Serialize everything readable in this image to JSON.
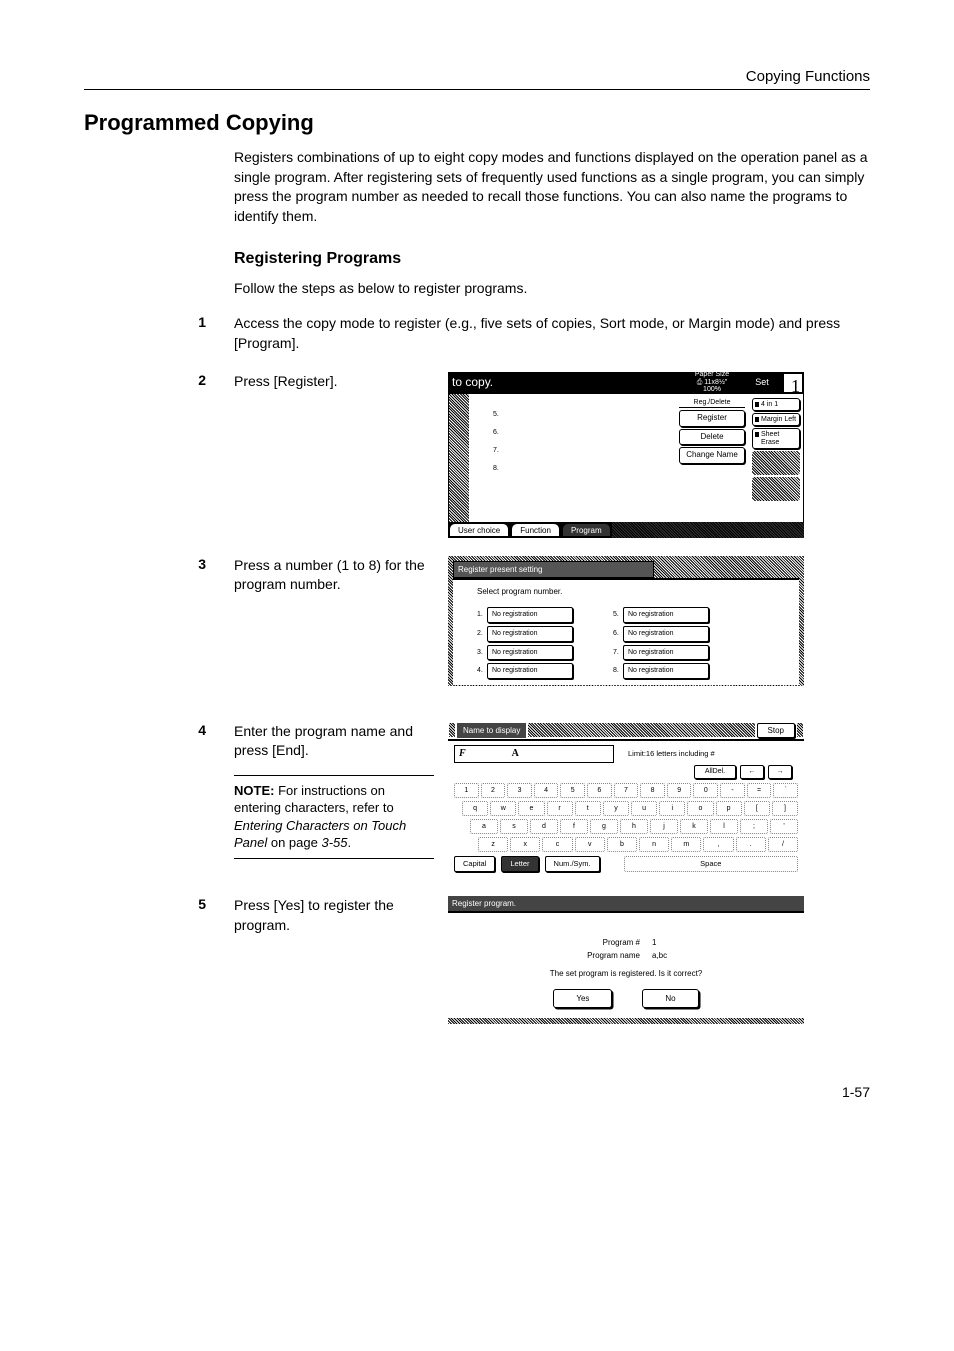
{
  "header": {
    "title": "Copying Functions"
  },
  "h1": "Programmed Copying",
  "intro": "Registers combinations of up to eight copy modes and functions displayed on the operation panel as a single program. After registering sets of frequently used functions as a single program, you can simply press the program number as needed to recall those functions. You can also name the programs to identify them.",
  "h2": "Registering Programs",
  "follow": "Follow the steps as below to register programs.",
  "steps": {
    "s1": {
      "num": "1",
      "text": "Access the copy mode to register (e.g., five sets of copies, Sort mode, or Margin mode) and press [Program]."
    },
    "s2": {
      "num": "2",
      "text": "Press [Register]."
    },
    "s3": {
      "num": "3",
      "text": "Press a number (1 to 8) for the program number."
    },
    "s4": {
      "num": "4",
      "text": "Enter the program name and press [End]."
    },
    "s5": {
      "num": "5",
      "text": "Press [Yes] to register the program."
    }
  },
  "note": {
    "label": "NOTE:",
    "text1": " For instructions on entering characters, refer to ",
    "ital": "Entering Characters on Touch Panel",
    "text2": " on page ",
    "page": "3-55",
    "period": "."
  },
  "screen1": {
    "title": "to copy.",
    "paper_size_label": "Paper Size",
    "paper_size": "11x8½\"",
    "zoom": "100%",
    "set": "Set",
    "count": "1",
    "list": [
      "5.",
      "6.",
      "7.",
      "8."
    ],
    "reg_delete": "Reg./Delete",
    "buttons": [
      "Register",
      "Delete",
      "Change Name"
    ],
    "side": [
      "4 in 1",
      "Margin Left",
      "Sheet Erase"
    ],
    "tabs": [
      "User choice",
      "Function",
      "Program"
    ]
  },
  "screen2": {
    "header": "Register present setting",
    "sub": "Select program number.",
    "cells": [
      {
        "n": "1.",
        "t": "No registration"
      },
      {
        "n": "2.",
        "t": "No registration"
      },
      {
        "n": "3.",
        "t": "No registration"
      },
      {
        "n": "4.",
        "t": "No registration"
      },
      {
        "n": "5.",
        "t": "No registration"
      },
      {
        "n": "6.",
        "t": "No registration"
      },
      {
        "n": "7.",
        "t": "No registration"
      },
      {
        "n": "8.",
        "t": "No registration"
      }
    ]
  },
  "screen3": {
    "title": "Name to display",
    "stop": "Stop",
    "input_value": "F",
    "cursor": "A",
    "limit": "Limit:16 letters including #",
    "alldel": "AllDel.",
    "arrow_l": "←",
    "arrow_r": "→",
    "rows": [
      [
        "1",
        "2",
        "3",
        "4",
        "5",
        "6",
        "7",
        "8",
        "9",
        "0",
        "-",
        "=",
        "`"
      ],
      [
        "q",
        "w",
        "e",
        "r",
        "t",
        "y",
        "u",
        "i",
        "o",
        "p",
        "[",
        "]"
      ],
      [
        "a",
        "s",
        "d",
        "f",
        "g",
        "h",
        "j",
        "k",
        "l",
        ";",
        "'"
      ],
      [
        "z",
        "x",
        "c",
        "v",
        "b",
        "n",
        "m",
        ",",
        ".",
        "/"
      ]
    ],
    "tabs": [
      "Capital",
      "Letter",
      "Num./Sym."
    ],
    "space": "Space"
  },
  "screen4": {
    "title": "Register program.",
    "lines": [
      {
        "lab": "Program #",
        "val": "1"
      },
      {
        "lab": "Program name",
        "val": "a,bc"
      }
    ],
    "question": "The set program is registered. Is it correct?",
    "yes": "Yes",
    "no": "No"
  },
  "pagenum": "1-57"
}
